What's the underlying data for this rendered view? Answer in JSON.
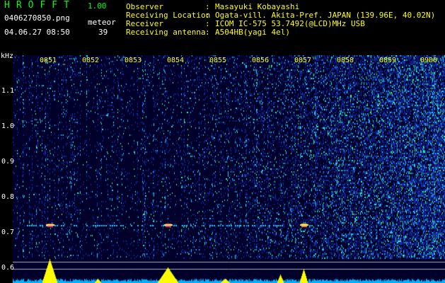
{
  "header": {
    "app_title": "HROFFT",
    "app_version": "1.00",
    "file_name": "0406270850.png",
    "meteor_label": "meteor",
    "datetime": "04.06.27 08:50",
    "meteor_count": "39"
  },
  "meta": [
    {
      "key": "Observer",
      "value": "Masayuki Kobayashi"
    },
    {
      "key": "Receiving Location",
      "value": "Ogata-vill. Akita-Pref. JAPAN (139.96E, 40.02N)"
    },
    {
      "key": "Receiver",
      "value": "ICOM IC-575 53.7492(@LCD)MHz USB"
    },
    {
      "key": "Receiving antenna",
      "value": "A504HB(yagi 4el)"
    }
  ],
  "spectrogram": {
    "unit": "kHz",
    "y_ticks": [
      "1.1",
      "1.0",
      "0.9",
      "0.8",
      "0.7",
      "0.6"
    ],
    "time_ticks": [
      "0851",
      "0852",
      "0853",
      "0854",
      "0855",
      "0856",
      "0857",
      "0858",
      "0859",
      "0900"
    ],
    "colors": {
      "background": "#00002a",
      "noise": "#1030b0",
      "bright": "#30c8ff",
      "hot": "#ff3060",
      "trace": "#ffff00",
      "ref_line": "#b0b0b0"
    }
  }
}
